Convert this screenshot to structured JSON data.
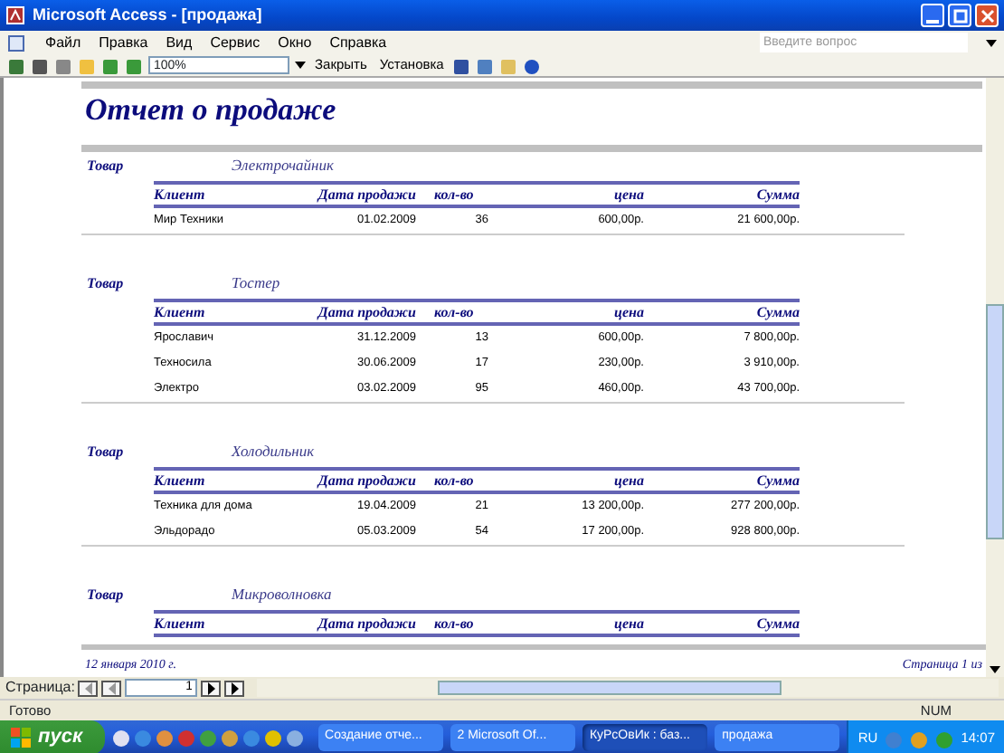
{
  "window": {
    "title": "Microsoft Access - [продажа]"
  },
  "menu": [
    "Файл",
    "Правка",
    "Вид",
    "Сервис",
    "Окно",
    "Справка"
  ],
  "help_search": {
    "placeholder": "Введите вопрос"
  },
  "toolbar": {
    "zoom": "100%",
    "buttons": [
      "Закрыть",
      "Установка"
    ]
  },
  "report": {
    "title": "Отчет о продаже",
    "groups": [
      {
        "label": "Товар",
        "product": "Электрочайник",
        "columns": [
          "Клиент",
          "Дата продажи",
          "кол-во",
          "цена",
          "Сумма"
        ],
        "rows": [
          [
            "Мир Техники",
            "01.02.2009",
            "36",
            "600,00р.",
            "21 600,00р."
          ]
        ]
      },
      {
        "label": "Товар",
        "product": "Тостер",
        "columns": [
          "Клиент",
          "Дата продажи",
          "кол-во",
          "цена",
          "Сумма"
        ],
        "rows": [
          [
            "Ярославич",
            "31.12.2009",
            "13",
            "600,00р.",
            "7 800,00р."
          ],
          [
            "Техносила",
            "30.06.2009",
            "17",
            "230,00р.",
            "3 910,00р."
          ],
          [
            "Электро",
            "03.02.2009",
            "95",
            "460,00р.",
            "43 700,00р."
          ]
        ]
      },
      {
        "label": "Товар",
        "product": "Холодильник",
        "columns": [
          "Клиент",
          "Дата продажи",
          "кол-во",
          "цена",
          "Сумма"
        ],
        "rows": [
          [
            "Техника для дома",
            "19.04.2009",
            "21",
            "13 200,00р.",
            "277 200,00р."
          ],
          [
            "Эльдорадо",
            "05.03.2009",
            "54",
            "17 200,00р.",
            "928 800,00р."
          ]
        ]
      },
      {
        "label": "Товар",
        "product": "Микроволновка",
        "columns": [
          "Клиент",
          "Дата продажи",
          "кол-во",
          "цена",
          "Сумма"
        ]
      }
    ],
    "footer": {
      "date": "12 января 2010 г.",
      "page": "Страница 1 из"
    }
  },
  "navigation": {
    "label": "Страница:",
    "page": "1"
  },
  "status_bar": {
    "text": "Готово",
    "indicator": "NUM"
  },
  "taskbar": {
    "start": "пуск",
    "tasks": [
      {
        "label": "Создание отче...",
        "selected": false
      },
      {
        "label": "2 Microsoft Of...",
        "selected": false
      },
      {
        "label": "КуРсОвИк : баз...",
        "selected": true
      },
      {
        "label": "продажа",
        "selected": false
      }
    ],
    "language": "RU",
    "clock": "14:07"
  }
}
